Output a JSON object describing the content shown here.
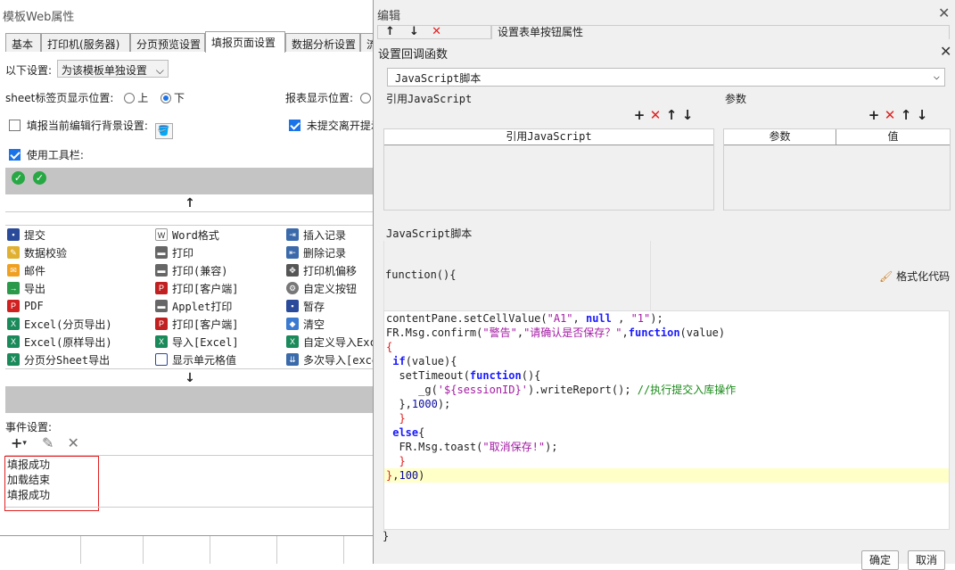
{
  "left": {
    "title": "模板Web属性",
    "tabs": [
      "基本",
      "打印机(服务器)",
      "分页预览设置",
      "填报页面设置",
      "数据分析设置",
      "流"
    ],
    "active_tab": "填报页面设置",
    "settings_label": "以下设置:",
    "settings_select": "为该模板单独设置",
    "sheet_tab_label": "sheet标签页显示位置:",
    "sheet_opt_top": "上",
    "sheet_opt_bottom": "下",
    "report_pos_label": "报表显示位置:",
    "bg_setting_label": "填报当前编辑行背景设置:",
    "unsubmitted_label": "未提交离开提示",
    "use_toolbar_label": "使用工具栏:",
    "buttons": [
      [
        "提交",
        "Word格式",
        "插入记录"
      ],
      [
        "数据校验",
        "打印",
        "删除记录"
      ],
      [
        "邮件",
        "打印(兼容)",
        "打印机偏移"
      ],
      [
        "导出",
        "打印[客户端]",
        "自定义按钮"
      ],
      [
        "PDF",
        "Applet打印",
        "暂存"
      ],
      [
        "Excel(分页导出)",
        "打印[客户端]",
        "清空"
      ],
      [
        "Excel(原样导出)",
        "导入[Excel]",
        "自定义导入Excel"
      ],
      [
        "分页分Sheet导出",
        "显示单元格值",
        "多次导入[excel]"
      ]
    ],
    "event_label": "事件设置:",
    "events": [
      "填报成功",
      "加载结束",
      "填报成功"
    ]
  },
  "editor": {
    "title": "编辑",
    "prop_title": "设置表单按钮属性"
  },
  "dialog": {
    "title": "设置回调函数",
    "type_select": "JavaScript脚本",
    "ref_js_label": "引用JavaScript",
    "ref_js_col": "引用JavaScript",
    "params_label": "参数",
    "params_col1": "参数",
    "params_col2": "值",
    "script_label": "JavaScript脚本",
    "func_header": "function(){",
    "format_label": "格式化代码",
    "code_end": "}",
    "ok": "确定",
    "cancel": "取消"
  },
  "colors": {
    "accent": "#1a73e8",
    "check_green": "#27a844",
    "delete_red": "#e02020",
    "highlight": "#ffffc8"
  }
}
